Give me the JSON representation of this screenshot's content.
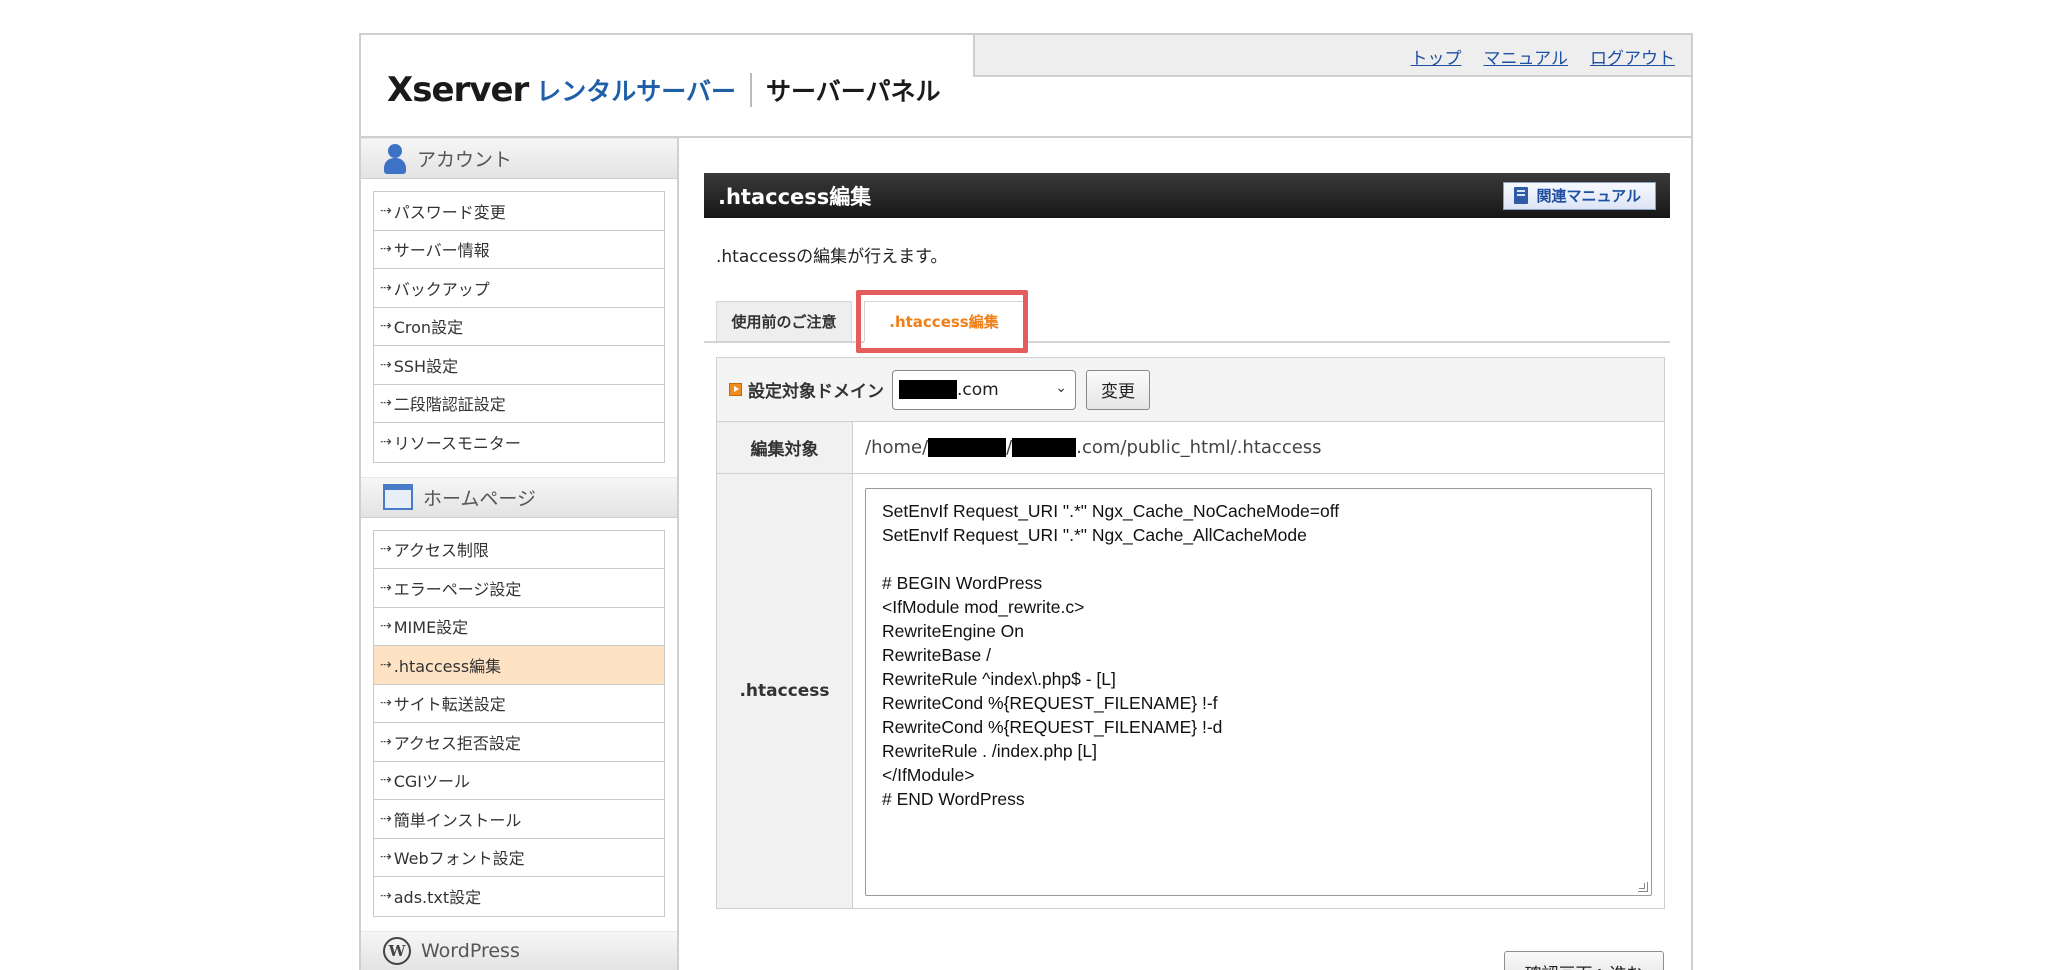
{
  "header": {
    "logo_main": "Xserver",
    "logo_sub": "レンタルサーバー",
    "logo_panel": "サーバーパネル",
    "links": [
      "トップ",
      "マニュアル",
      "ログアウト"
    ]
  },
  "sidebar": {
    "sections": [
      {
        "title": "アカウント",
        "icon": "person-icon",
        "items": [
          "パスワード変更",
          "サーバー情報",
          "バックアップ",
          "Cron設定",
          "SSH設定",
          "二段階認証設定",
          "リソースモニター"
        ]
      },
      {
        "title": "ホームページ",
        "icon": "page-icon",
        "items": [
          "アクセス制限",
          "エラーページ設定",
          "MIME設定",
          ".htaccess編集",
          "サイト転送設定",
          "アクセス拒否設定",
          "CGIツール",
          "簡単インストール",
          "Webフォント設定",
          "ads.txt設定"
        ],
        "active_item": ".htaccess編集"
      },
      {
        "title": "WordPress",
        "icon": "wordpress-icon",
        "items": []
      }
    ]
  },
  "main": {
    "title": ".htaccess編集",
    "manual_button": "関連マニュアル",
    "description": ".htaccessの編集が行えます。",
    "tabs": [
      {
        "label": "使用前のご注意",
        "active": false
      },
      {
        "label": ".htaccess編集",
        "active": true
      }
    ],
    "domain_label": "設定対象ドメイン",
    "domain_suffix": ".com",
    "change_button": "変更",
    "path_label": "編集対象",
    "path_prefix": "/home/",
    "path_sep": "/",
    "path_suffix": ".com/public_html/.htaccess",
    "htaccess_label": ".htaccess",
    "htaccess_lines": [
      "SetEnvIf Request_URI \".*\" Ngx_Cache_NoCacheMode=off",
      "SetEnvIf Request_URI \".*\" Ngx_Cache_AllCacheMode",
      "",
      "# BEGIN WordPress",
      "<IfModule mod_rewrite.c>",
      "RewriteEngine On",
      "RewriteBase /",
      "RewriteRule ^index\\.php$ - [L]",
      "RewriteCond %{REQUEST_FILENAME} !-f",
      "RewriteCond %{REQUEST_FILENAME} !-d",
      "RewriteRule . /index.php [L]",
      "</IfModule>",
      "# END WordPress"
    ],
    "confirm_button": "確認画面へ進む"
  },
  "colors": {
    "accent_orange": "#f07f17",
    "highlight_red": "#e45c5c",
    "link_blue": "#1e4fa0",
    "active_item_bg": "#fde3c4"
  }
}
